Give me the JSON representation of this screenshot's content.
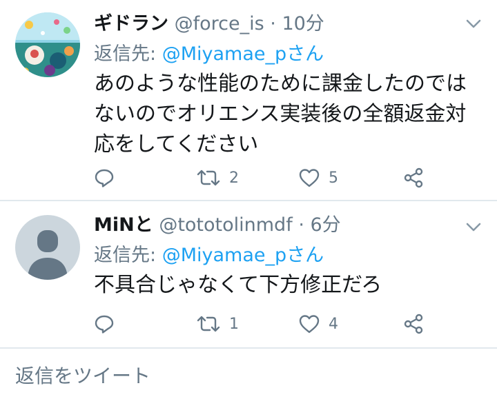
{
  "tweets": [
    {
      "display_name": "ギドラン",
      "handle": "@force_is",
      "separator": "·",
      "time": "10分",
      "reply_prefix": "返信先:",
      "reply_mention": "@Miyamae_pさん",
      "text": "あのような性能のために課金したのではないのでオリエンス実装後の全額返金対応をしてください",
      "retweets": "2",
      "likes": "5"
    },
    {
      "display_name": "MiNと",
      "handle": "@tototolinmdf",
      "separator": "·",
      "time": "6分",
      "reply_prefix": "返信先:",
      "reply_mention": "@Miyamae_pさん",
      "text": "不具合じゃなくて下方修正だろ",
      "retweets": "1",
      "likes": "4"
    }
  ],
  "compose": {
    "placeholder": "返信をツイート"
  },
  "colors": {
    "text": "#14171a",
    "secondary": "#657786",
    "accent": "#1da1f2",
    "divider": "#e1e8ed"
  },
  "icons": [
    "chevron-down-icon",
    "reply-icon",
    "retweet-icon",
    "like-icon",
    "share-icon"
  ]
}
